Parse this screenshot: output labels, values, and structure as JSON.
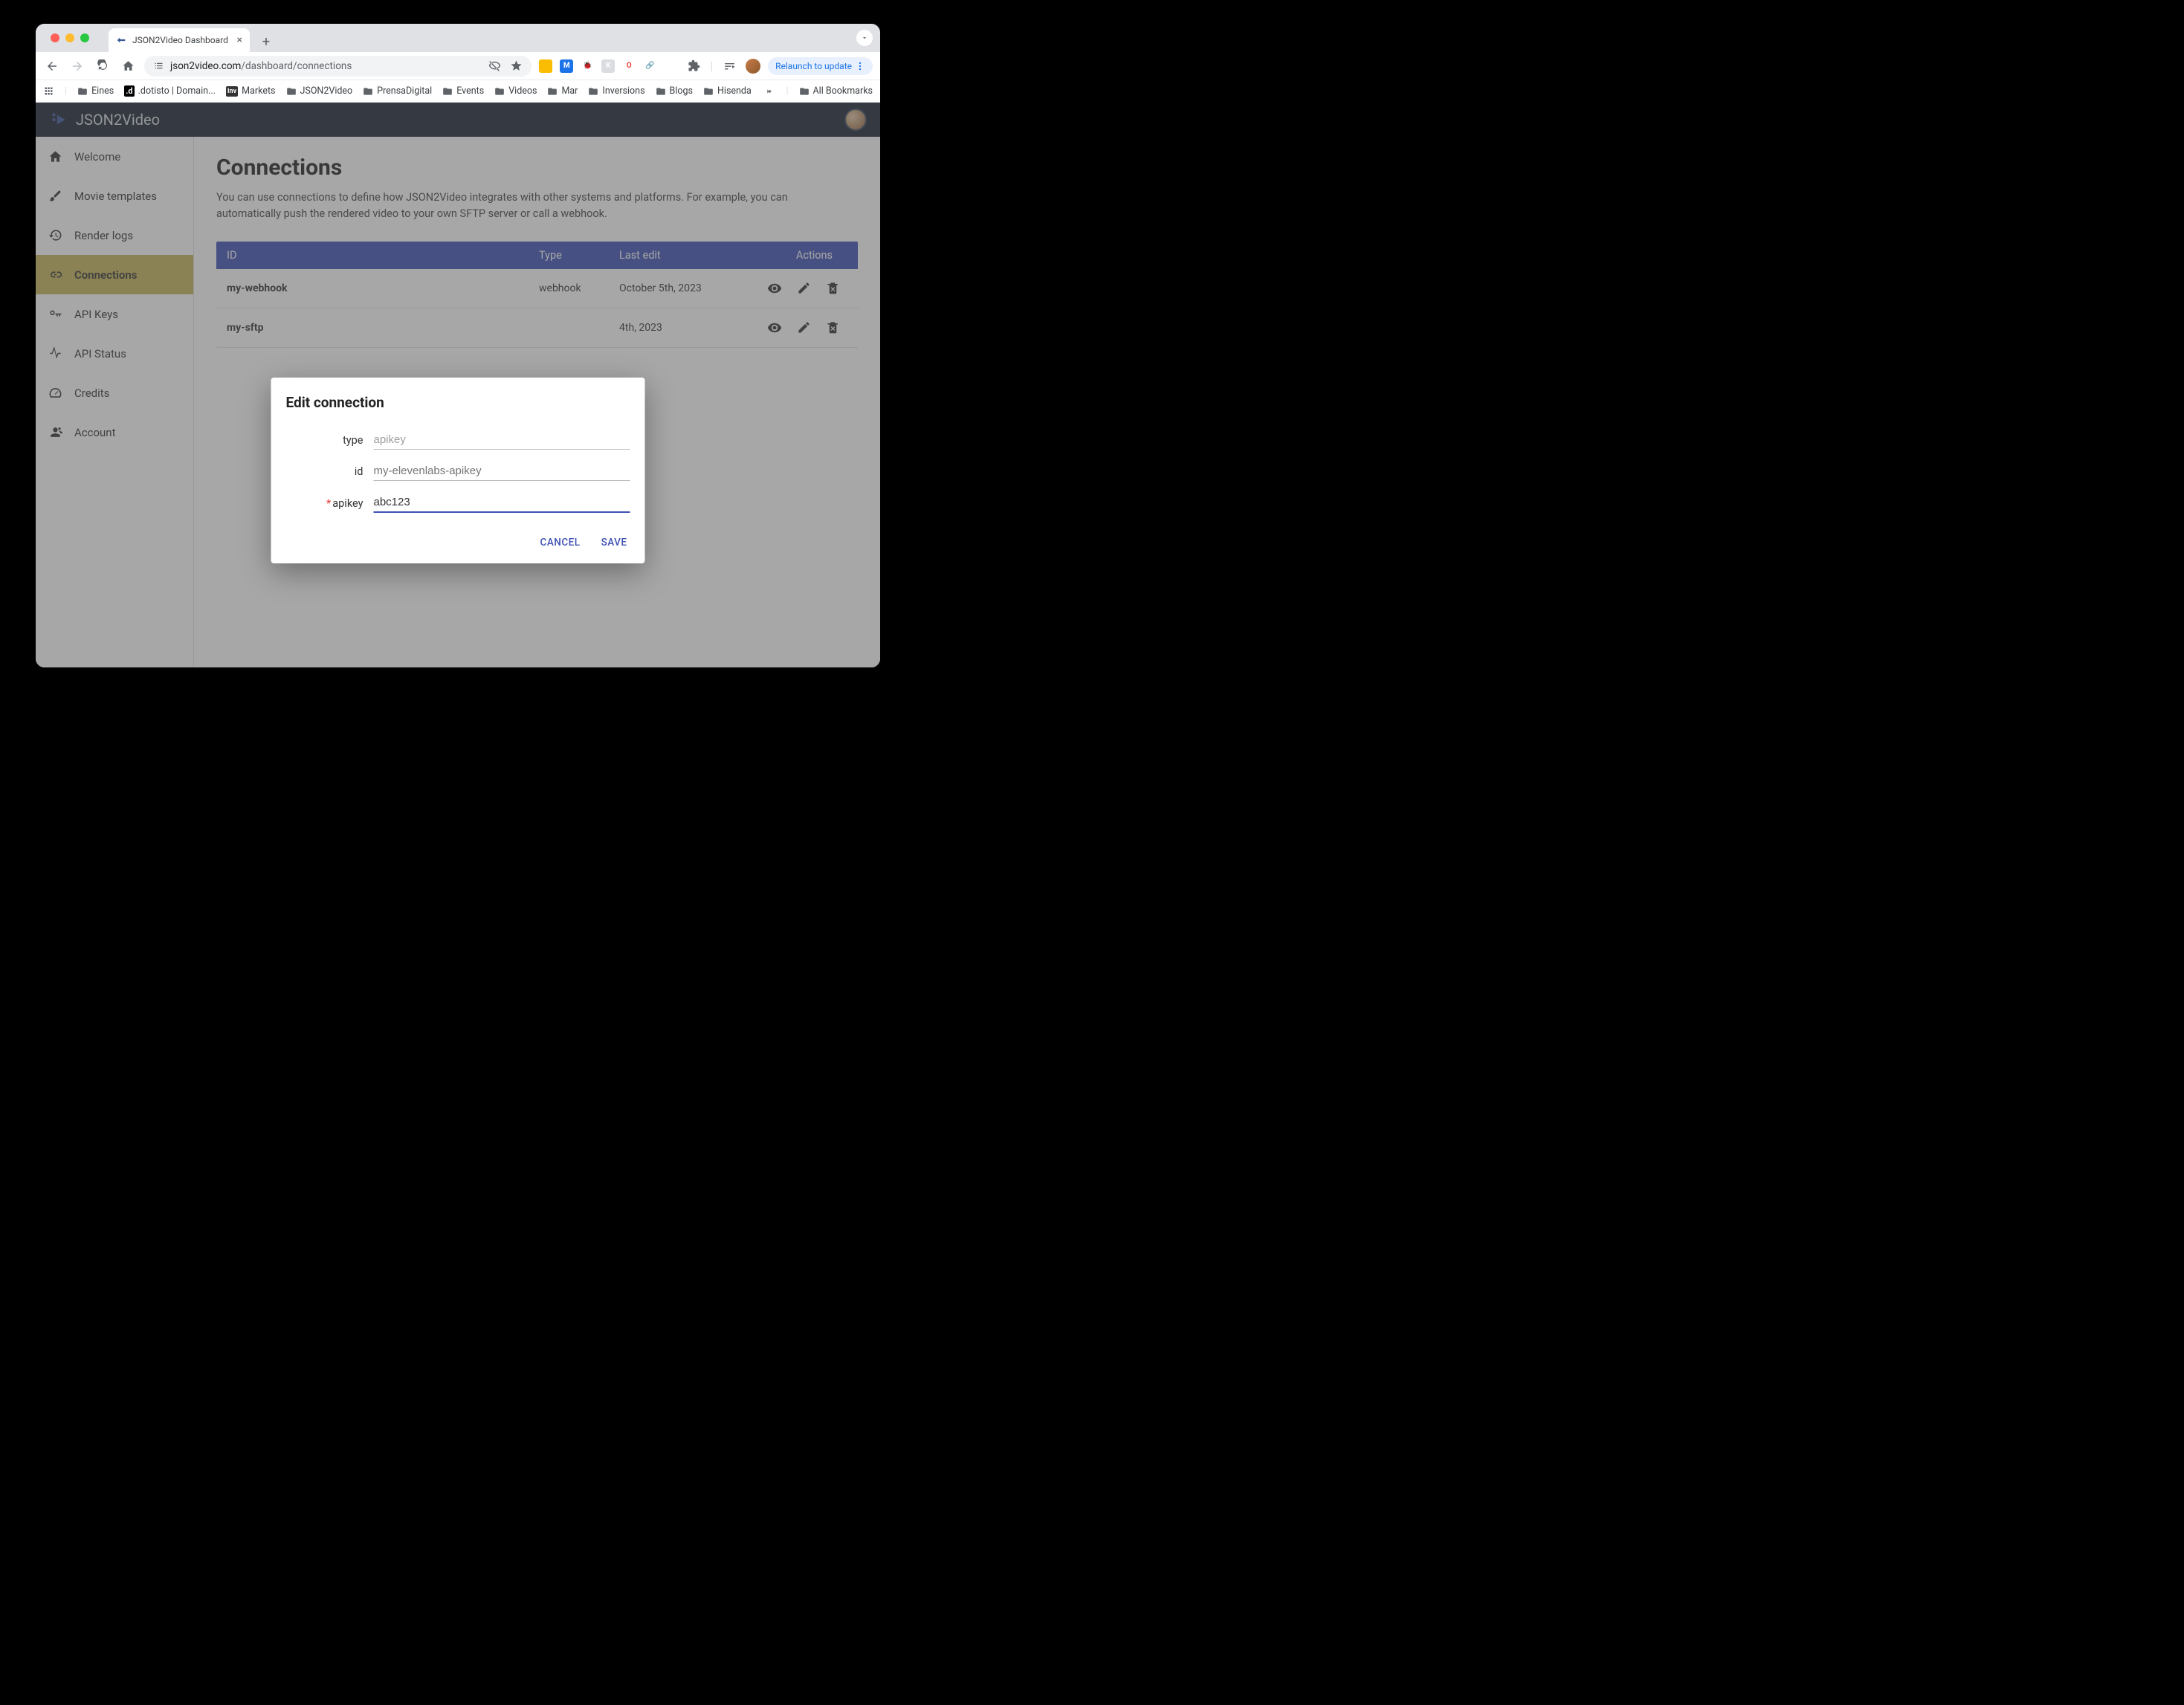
{
  "browser": {
    "tab_title": "JSON2Video Dashboard",
    "url_domain": "json2video.com",
    "url_path": "/dashboard/connections",
    "relaunch_label": "Relaunch to update"
  },
  "bookmarks": {
    "items": [
      {
        "label": "Eines"
      },
      {
        "label": ".dotisto | Domain..."
      },
      {
        "label": "Markets"
      },
      {
        "label": "JSON2Video"
      },
      {
        "label": "PrensaDigital"
      },
      {
        "label": "Events"
      },
      {
        "label": "Videos"
      },
      {
        "label": "Mar"
      },
      {
        "label": "Inversions"
      },
      {
        "label": "Blogs"
      },
      {
        "label": "Hisenda"
      }
    ],
    "all_label": "All Bookmarks"
  },
  "app": {
    "brand": "JSON2Video"
  },
  "sidebar": {
    "items": [
      {
        "label": "Welcome",
        "icon": "home"
      },
      {
        "label": "Movie templates",
        "icon": "brush"
      },
      {
        "label": "Render logs",
        "icon": "history"
      },
      {
        "label": "Connections",
        "icon": "link"
      },
      {
        "label": "API Keys",
        "icon": "key"
      },
      {
        "label": "API Status",
        "icon": "pulse"
      },
      {
        "label": "Credits",
        "icon": "gauge"
      },
      {
        "label": "Account",
        "icon": "user"
      }
    ],
    "active_index": 3
  },
  "page": {
    "title": "Connections",
    "description": "You can use connections to define how JSON2Video integrates with other systems and platforms. For example, you can automatically push the rendered video to your own SFTP server or call a webhook."
  },
  "table": {
    "headers": {
      "id": "ID",
      "type": "Type",
      "last_edit": "Last edit",
      "actions": "Actions"
    },
    "rows": [
      {
        "id": "my-webhook",
        "type": "webhook",
        "last_edit": "October 5th, 2023"
      },
      {
        "id": "my-sftp",
        "type": "",
        "last_edit": "4th, 2023"
      }
    ]
  },
  "modal": {
    "title": "Edit connection",
    "fields": {
      "type": {
        "label": "type",
        "value": "apikey",
        "readonly": true
      },
      "id": {
        "label": "id",
        "placeholder": "my-elevenlabs-apikey",
        "value": ""
      },
      "apikey": {
        "label": "apikey",
        "required": true,
        "value": "abc123"
      }
    },
    "cancel_label": "CANCEL",
    "save_label": "SAVE"
  },
  "ext_icons": [
    {
      "bg": "#fbbc04",
      "txt": ""
    },
    {
      "bg": "#1a73e8",
      "txt": "M"
    },
    {
      "bg": "#fff",
      "txt": "🐞"
    },
    {
      "bg": "#dadce0",
      "txt": "K"
    },
    {
      "bg": "#fff",
      "txt": "O",
      "color": "#ea4335"
    },
    {
      "bg": "#fff",
      "txt": "🔗"
    },
    {
      "bg": "#fff",
      "txt": "👁"
    }
  ]
}
